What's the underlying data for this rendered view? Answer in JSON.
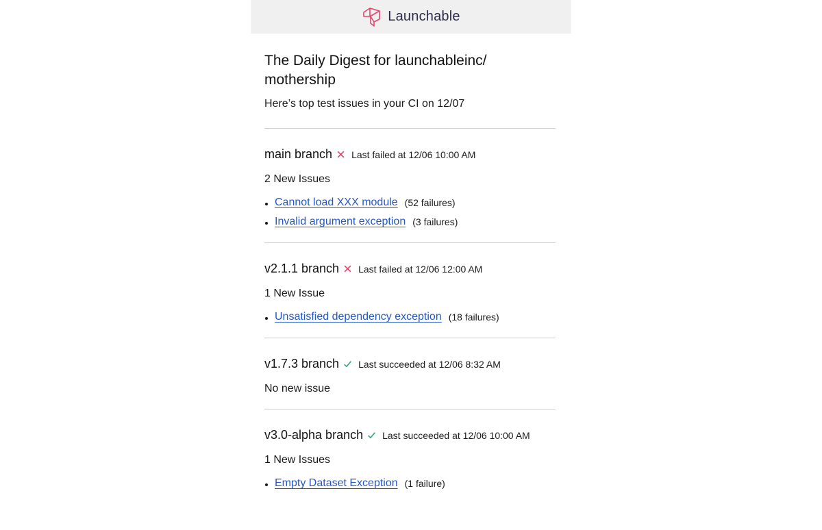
{
  "header": {
    "brand": "Launchable",
    "brand_color": "#e8446b"
  },
  "digest": {
    "title": "The Daily Digest for launchableinc/ mothership",
    "subtitle": "Here’s top test issues in your CI on 12/07"
  },
  "branches": [
    {
      "name": "main branch",
      "status": "failed",
      "status_text": "Last failed at 12/06 10:00 AM",
      "issue_count": "2 New Issues",
      "issues": [
        {
          "title": "Cannot load XXX module",
          "failures": "(52 failures)"
        },
        {
          "title": "Invalid argument exception",
          "failures": "(3 failures)"
        }
      ]
    },
    {
      "name": "v2.1.1 branch",
      "status": "failed",
      "status_text": "Last failed at 12/06 12:00 AM",
      "issue_count": "1 New Issue",
      "issues": [
        {
          "title": "Unsatisfied dependency exception",
          "failures": "(18 failures)"
        }
      ]
    },
    {
      "name": "v1.7.3 branch",
      "status": "succeeded",
      "status_text": "Last succeeded at 12/06 8:32 AM",
      "issue_count": "No new issue",
      "issues": []
    },
    {
      "name": "v3.0-alpha branch",
      "status": "succeeded",
      "status_text": "Last succeeded at 12/06 10:00 AM",
      "issue_count": "1 New Issues",
      "issues": [
        {
          "title": "Empty Dataset Exception",
          "failures": "(1 failure)"
        }
      ]
    }
  ],
  "colors": {
    "fail": "#e0446a",
    "success": "#3aa57a",
    "link": "#2457c5"
  }
}
